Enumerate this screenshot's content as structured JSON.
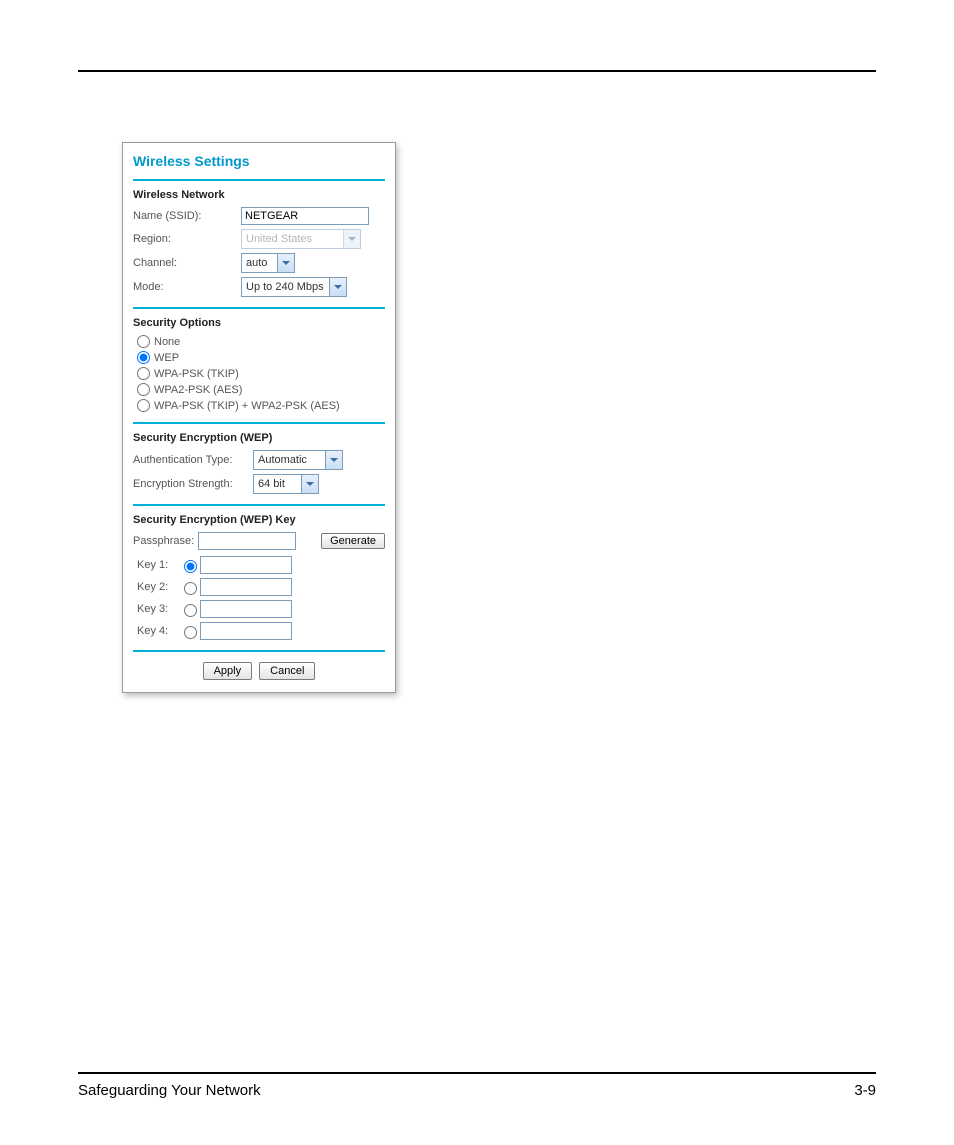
{
  "footer": {
    "section": "Safeguarding Your Network",
    "page": "3-9"
  },
  "panel": {
    "title": "Wireless Settings",
    "network": {
      "heading": "Wireless Network",
      "name_label": "Name (SSID):",
      "name_value": "NETGEAR",
      "region_label": "Region:",
      "region_value": "United States",
      "channel_label": "Channel:",
      "channel_value": "auto",
      "mode_label": "Mode:",
      "mode_value": "Up to 240 Mbps"
    },
    "security_options": {
      "heading": "Security Options",
      "options": [
        {
          "label": "None",
          "selected": false
        },
        {
          "label": "WEP",
          "selected": true
        },
        {
          "label": "WPA-PSK (TKIP)",
          "selected": false
        },
        {
          "label": "WPA2-PSK (AES)",
          "selected": false
        },
        {
          "label": "WPA-PSK (TKIP) + WPA2-PSK (AES)",
          "selected": false
        }
      ]
    },
    "wep": {
      "heading": "Security Encryption (WEP)",
      "auth_label": "Authentication Type:",
      "auth_value": "Automatic",
      "strength_label": "Encryption Strength:",
      "strength_value": "64 bit"
    },
    "wep_key": {
      "heading": "Security Encryption (WEP) Key",
      "passphrase_label": "Passphrase:",
      "passphrase_value": "",
      "generate_label": "Generate",
      "keys": [
        {
          "label": "Key 1:",
          "selected": true,
          "value": ""
        },
        {
          "label": "Key 2:",
          "selected": false,
          "value": ""
        },
        {
          "label": "Key 3:",
          "selected": false,
          "value": ""
        },
        {
          "label": "Key 4:",
          "selected": false,
          "value": ""
        }
      ]
    },
    "buttons": {
      "apply": "Apply",
      "cancel": "Cancel"
    }
  }
}
